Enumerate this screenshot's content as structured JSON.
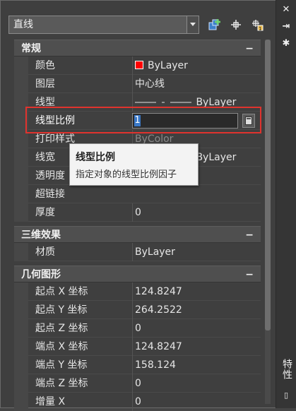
{
  "object_select": {
    "value": "直线"
  },
  "palette_title": "特性",
  "sections": {
    "general": {
      "title": "常规",
      "collapse": "−"
    },
    "3d": {
      "title": "三维效果",
      "collapse": "−"
    },
    "geometry": {
      "title": "几何图形",
      "collapse": "−"
    }
  },
  "general_rows": {
    "color": {
      "label": "颜色",
      "value": "ByLayer",
      "swatch": "#ff0000"
    },
    "layer": {
      "label": "图层",
      "value": "中心线"
    },
    "linetype": {
      "label": "线型",
      "value": "ByLayer"
    },
    "ltscale": {
      "label": "线型比例",
      "value": "1"
    },
    "plotstyle": {
      "label": "打印样式",
      "value": "ByColor"
    },
    "lineweight": {
      "label": "线宽",
      "value": "ByLayer"
    },
    "transparency": {
      "label": "透明度",
      "value": ""
    },
    "hyperlink": {
      "label": "超链接",
      "value": ""
    },
    "thickness": {
      "label": "厚度",
      "value": "0"
    }
  },
  "threed_rows": {
    "material": {
      "label": "材质",
      "value": "ByLayer"
    }
  },
  "geometry_rows": [
    {
      "label": "起点 X 坐标",
      "value": "124.8247"
    },
    {
      "label": "起点 Y 坐标",
      "value": "264.2522"
    },
    {
      "label": "起点 Z 坐标",
      "value": "0"
    },
    {
      "label": "端点 X 坐标",
      "value": "124.8247"
    },
    {
      "label": "端点 Y 坐标",
      "value": "158.124"
    },
    {
      "label": "端点 Z 坐标",
      "value": "0"
    },
    {
      "label": "增量 X",
      "value": "0"
    }
  ],
  "tooltip": {
    "title": "线型比例",
    "description": "指定对象的线型比例因子"
  },
  "colors": {
    "highlight": "#e0332e",
    "selection": "#3a78c7"
  }
}
